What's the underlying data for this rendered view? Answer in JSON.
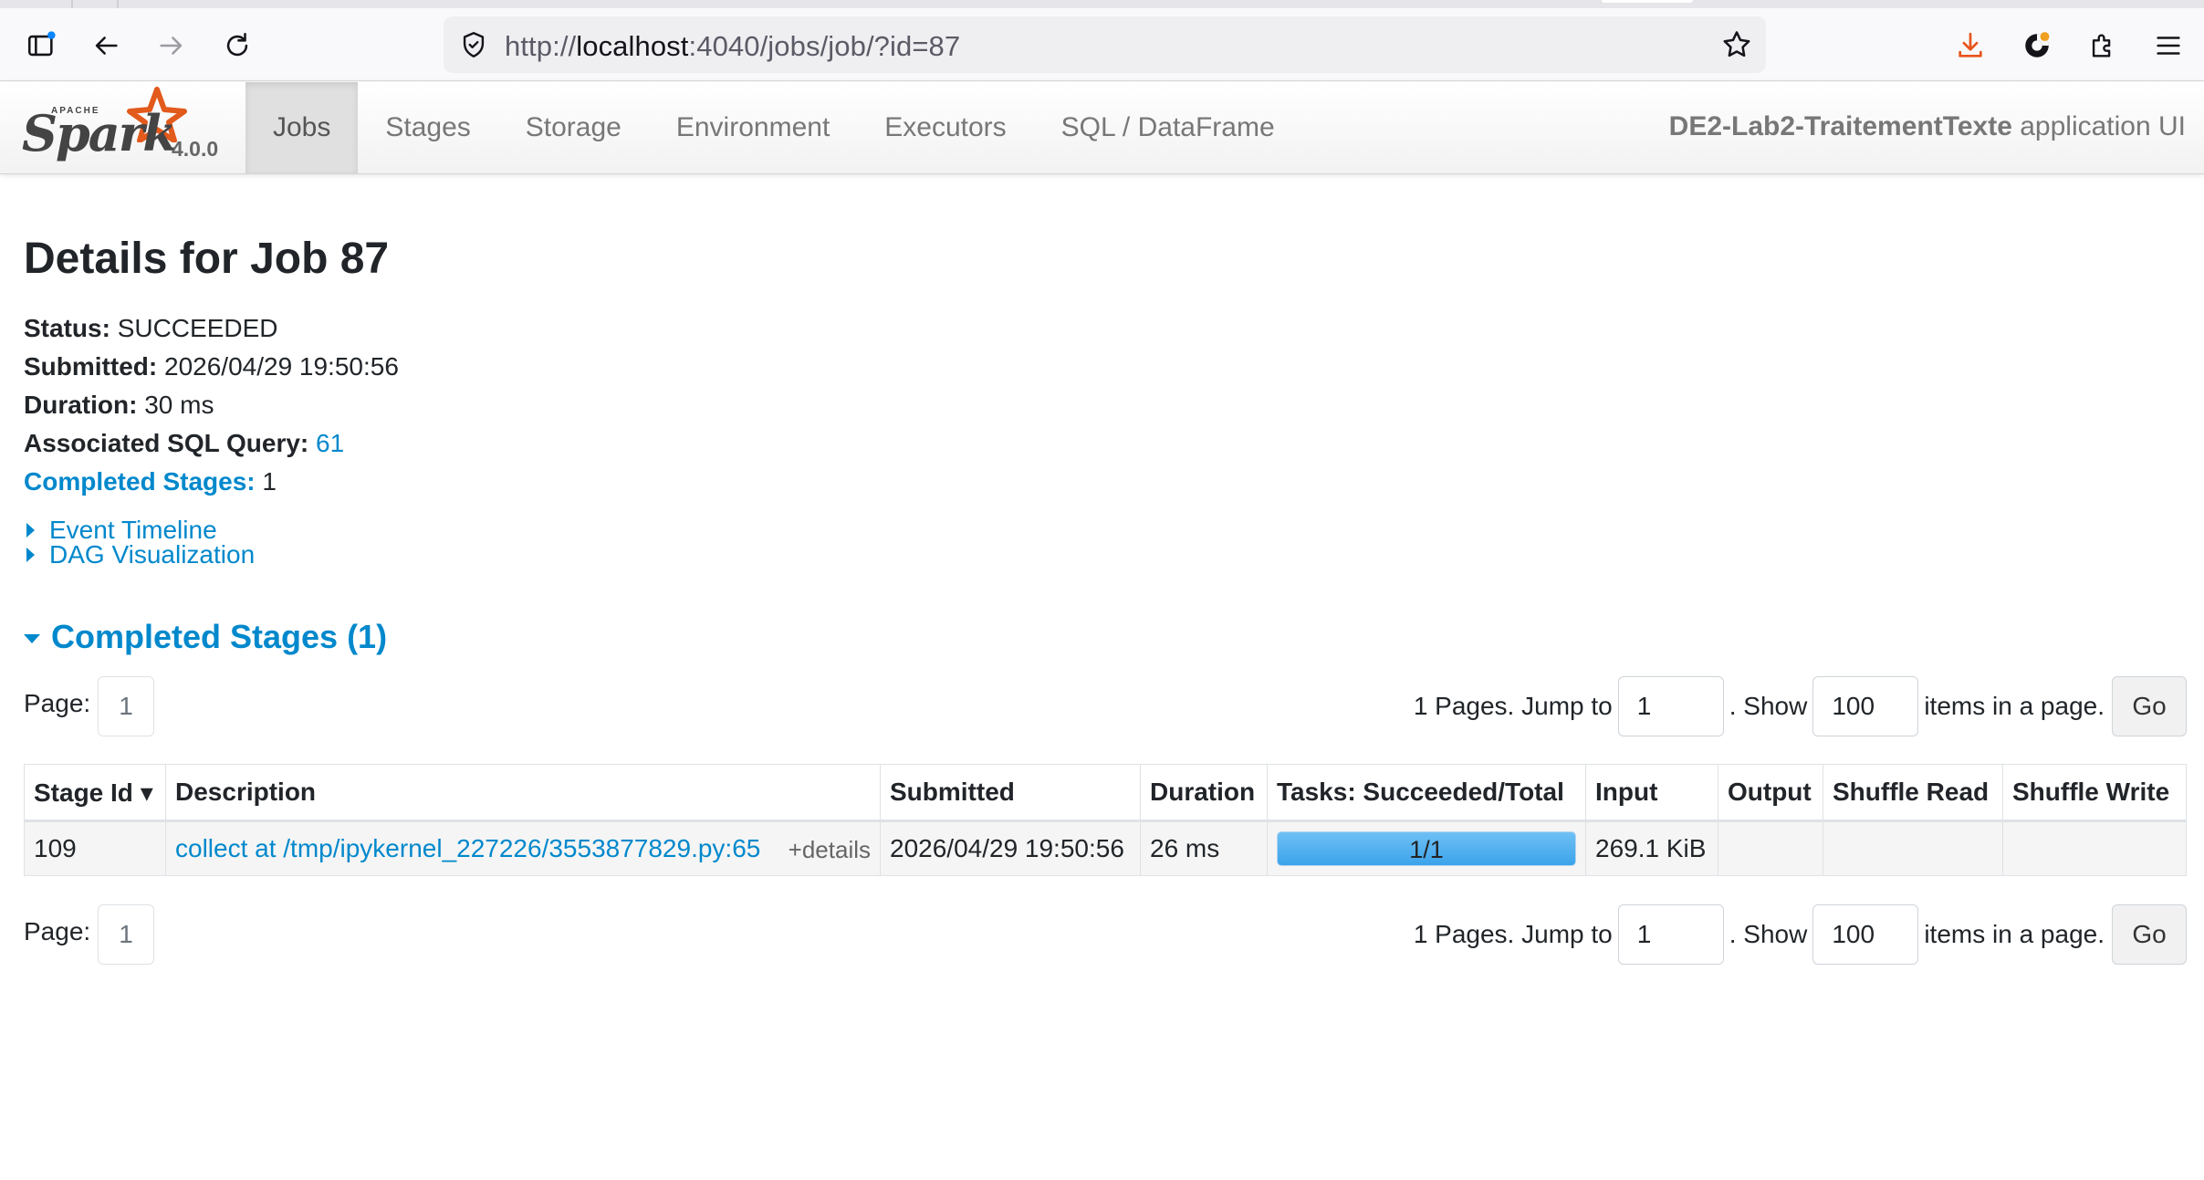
{
  "browser": {
    "url_prefix": "http://",
    "url_host": "localhost",
    "url_rest": ":4040/jobs/job/?id=87"
  },
  "spark": {
    "brand_apache": "APACHE",
    "brand_name": "Spark",
    "version": "4.0.0",
    "tabs": [
      "Jobs",
      "Stages",
      "Storage",
      "Environment",
      "Executors",
      "SQL / DataFrame"
    ],
    "active_tab": "Jobs",
    "app_name": "DE2-Lab2-TraitementTexte",
    "app_suffix": "application UI"
  },
  "job": {
    "title": "Details for Job 87",
    "status_label": "Status:",
    "status_value": "SUCCEEDED",
    "submitted_label": "Submitted:",
    "submitted_value": "2026/04/29 19:50:56",
    "duration_label": "Duration:",
    "duration_value": "30 ms",
    "sql_label": "Associated SQL Query:",
    "sql_value": "61",
    "completed_label": "Completed Stages:",
    "completed_value": "1",
    "event_timeline": "Event Timeline",
    "dag_visualization": "DAG Visualization",
    "section_title": "Completed Stages (1)"
  },
  "pager": {
    "page_label": "Page:",
    "page_value": "1",
    "pages_text": "1 Pages. Jump to",
    "jump_value": "1",
    "show_text": ". Show",
    "show_value": "100",
    "items_text": "items in a page.",
    "go_label": "Go"
  },
  "table": {
    "headers": [
      "Stage Id ▾",
      "Description",
      "Submitted",
      "Duration",
      "Tasks: Succeeded/Total",
      "Input",
      "Output",
      "Shuffle Read",
      "Shuffle Write"
    ],
    "rows": [
      {
        "stage_id": "109",
        "description": "collect at /tmp/ipykernel_227226/3553877829.py:65",
        "details": "+details",
        "submitted": "2026/04/29 19:50:56",
        "duration": "26 ms",
        "tasks": "1/1",
        "tasks_fraction": 1.0,
        "input": "269.1 KiB",
        "output": "",
        "shuffle_read": "",
        "shuffle_write": ""
      }
    ]
  },
  "colors": {
    "link": "#0088cc",
    "progress": "#3ba3ea",
    "download_icon": "#e8541c"
  }
}
